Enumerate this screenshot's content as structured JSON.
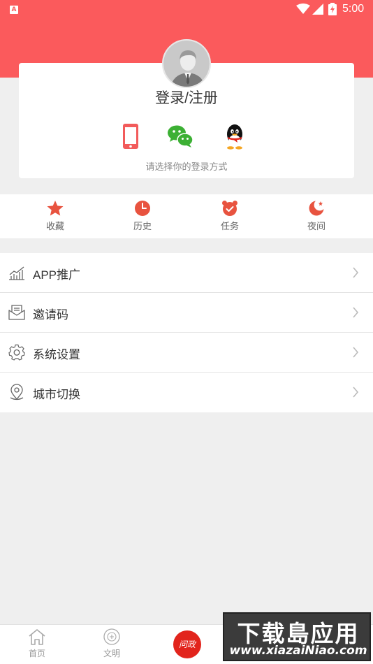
{
  "status_bar": {
    "app_badge": "A",
    "time": "5:00"
  },
  "profile": {
    "login_title": "登录/注册",
    "login_hint": "请选择你的登录方式",
    "methods": [
      "phone-icon",
      "wechat-icon",
      "qq-icon"
    ]
  },
  "quick_actions": [
    {
      "label": "收藏",
      "icon": "star-icon"
    },
    {
      "label": "历史",
      "icon": "clock-icon"
    },
    {
      "label": "任务",
      "icon": "alarm-icon"
    },
    {
      "label": "夜间",
      "icon": "moon-icon"
    }
  ],
  "menu": [
    {
      "label": "APP推广",
      "icon": "chart-icon"
    },
    {
      "label": "邀请码",
      "icon": "envelope-icon"
    },
    {
      "label": "系统设置",
      "icon": "gear-icon"
    },
    {
      "label": "城市切换",
      "icon": "location-icon"
    }
  ],
  "tabbar": {
    "home_label": "首页",
    "civilization_label": "文明",
    "center_label": "问政"
  },
  "watermark": {
    "title": "下载島应用",
    "url": "www.xiazaiNiao.com"
  },
  "colors": {
    "brand": "#fb5a5c",
    "accent": "#e8533f"
  }
}
